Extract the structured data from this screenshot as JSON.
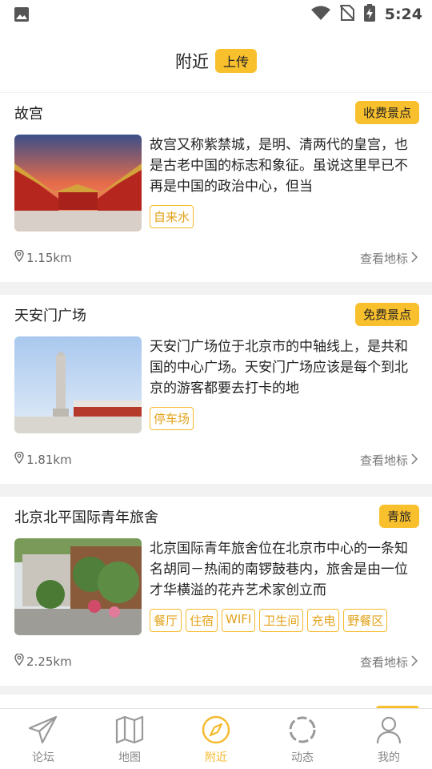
{
  "status_bar": {
    "time": "5:24"
  },
  "header": {
    "title": "附近",
    "upload_label": "上传"
  },
  "cards": [
    {
      "title": "故宫",
      "badge": "收费景点",
      "description": "故宫又称紫禁城，是明、清两代的皇宫，也是古老中国的标志和象征。虽说这里早已不再是中国的政治中心，但当",
      "tags": [
        "自来水"
      ],
      "distance": "1.15km",
      "link": "查看地标"
    },
    {
      "title": "天安门广场",
      "badge": "免费景点",
      "description": "天安门广场位于北京市的中轴线上，是共和国的中心广场。天安门广场应该是每个到北京的游客都要去打卡的地",
      "tags": [
        "停车场"
      ],
      "distance": "1.81km",
      "link": "查看地标"
    },
    {
      "title": "北京北平国际青年旅舍",
      "badge": "青旅",
      "description": " 北京国际青年旅舍位在北京市中心的一条知名胡同－热闹的南锣鼓巷内，旅舍是由一位才华横溢的花卉艺术家创立而",
      "tags": [
        "餐厅",
        "住宿",
        "WIFI",
        "卫生间",
        "充电",
        "野餐区"
      ],
      "distance": "2.25km",
      "link": "查看地标"
    }
  ],
  "bottom_nav": {
    "items": [
      {
        "label": "论坛",
        "icon": "paper-plane-icon"
      },
      {
        "label": "地图",
        "icon": "map-icon"
      },
      {
        "label": "附近",
        "icon": "compass-icon",
        "active": true
      },
      {
        "label": "动态",
        "icon": "refresh-ring-icon"
      },
      {
        "label": "我的",
        "icon": "person-icon"
      }
    ]
  },
  "colors": {
    "accent": "#f9c02e",
    "tag_border": "#f5b92b",
    "background": "#f2f2f2"
  }
}
